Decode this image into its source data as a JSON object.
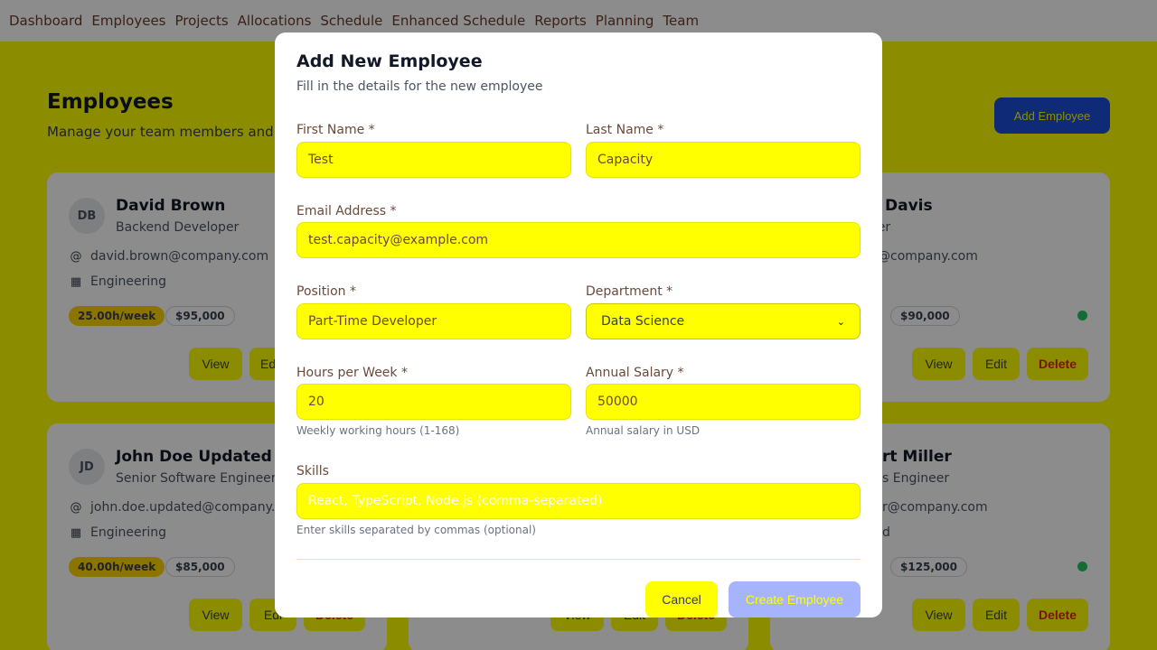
{
  "nav": [
    "Dashboard",
    "Employees",
    "Projects",
    "Allocations",
    "Schedule",
    "Enhanced Schedule",
    "Reports",
    "Planning",
    "Team"
  ],
  "page": {
    "title": "Employees",
    "subtitle": "Manage your team members and",
    "add_button": "Add Employee"
  },
  "cards": [
    {
      "initials": "DB",
      "name": "David Brown",
      "role": "Backend Developer",
      "email": "david.brown@company.com",
      "department": "Engineering",
      "hours": "25.00h/week",
      "salary": "$95,000",
      "view": "View",
      "edit": "Edi"
    },
    {
      "initials": "JD",
      "name": "John Doe Updated",
      "role": "Senior Software Engineer",
      "email": "john.doe.updated@company.co",
      "department": "Engineering",
      "hours": "40.00h/week",
      "salary": "$85,000",
      "view": "View",
      "edit": "Edi",
      "delete": "Delete"
    },
    {
      "name": "Davis",
      "role": "gner",
      "email": "@company.com",
      "salary": "$90,000",
      "view": "View",
      "edit": "Edit",
      "delete": "Delete"
    },
    {
      "name": "rt Miller",
      "role": "s Engineer",
      "email": "r@company.com",
      "dept_partial": "d",
      "salary": "$125,000",
      "view": "View",
      "edit": "Edit",
      "delete": "Delete"
    }
  ],
  "middle_buttons": {
    "view": "View",
    "edit": "Edit",
    "delete": "Delete"
  },
  "modal": {
    "title": "Add New Employee",
    "subtitle": "Fill in the details for the new employee",
    "first_name": {
      "label": "First Name *",
      "value": "Test"
    },
    "last_name": {
      "label": "Last Name *",
      "value": "Capacity"
    },
    "email": {
      "label": "Email Address *",
      "value": "test.capacity@example.com"
    },
    "position": {
      "label": "Position *",
      "value": "Part-Time Developer"
    },
    "department": {
      "label": "Department *",
      "value": "Data Science"
    },
    "hours": {
      "label": "Hours per Week *",
      "value": "20",
      "hint": "Weekly working hours (1-168)"
    },
    "salary": {
      "label": "Annual Salary *",
      "value": "50000",
      "hint": "Annual salary in USD"
    },
    "skills": {
      "label": "Skills",
      "placeholder": "React, TypeScript, Node.js (comma-separated)",
      "hint": "Enter skills separated by commas (optional)"
    },
    "cancel": "Cancel",
    "create": "Create Employee"
  },
  "colors": {
    "background": "#ffff00",
    "primary": "#1d4ed8",
    "create_disabled": "#a5b4fc",
    "status": "#22c55e",
    "danger": "#dc2626"
  }
}
